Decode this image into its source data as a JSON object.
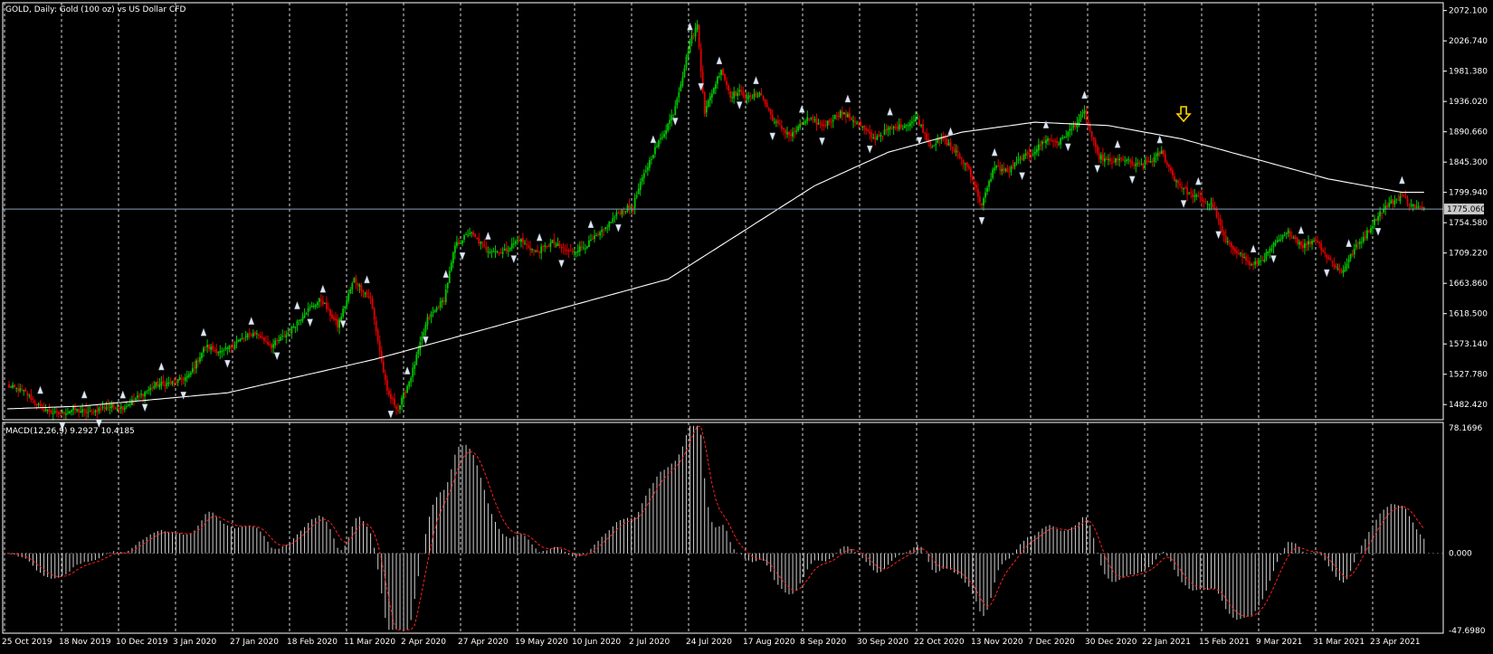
{
  "colors": {
    "background": "#000000",
    "frame": "#ffffff",
    "grid": "#ffffff",
    "bull": "#00c800",
    "bear": "#e00000",
    "ma": "#ffffff",
    "bid_line": "#8aa0b8",
    "macd_hist": "#d0d0d0",
    "macd_signal": "#ff2020",
    "arrow_marker": "#ffd400",
    "price_box": "#c8c8c8",
    "price_box_text": "#000000"
  },
  "chart_data": [
    {
      "type": "candlestick",
      "title": "GOLD, Daily:  Gold (100 oz) vs US Dollar CFD",
      "symbol": "GOLD",
      "timeframe": "Daily",
      "description": "Gold (100 oz) vs US Dollar CFD",
      "current_price": "1775.060",
      "y_ticks": [
        "2072.100",
        "2026.740",
        "1981.380",
        "1936.020",
        "1890.660",
        "1845.300",
        "1799.940",
        "1754.580",
        "1709.220",
        "1663.860",
        "1618.500",
        "1573.140",
        "1527.780",
        "1482.420"
      ],
      "ylim": [
        1459.74,
        2083.8
      ],
      "x_ticks": [
        "25 Oct 2019",
        "18 Nov 2019",
        "10 Dec 2019",
        "3 Jan 2020",
        "27 Jan 2020",
        "18 Feb 2020",
        "11 Mar 2020",
        "2 Apr 2020",
        "27 Apr 2020",
        "19 May 2020",
        "10 Jun 2020",
        "2 Jul 2020",
        "24 Jul 2020",
        "17 Aug 2020",
        "8 Sep 2020",
        "30 Sep 2020",
        "22 Oct 2020",
        "13 Nov 2020",
        "7 Dec 2020",
        "30 Dec 2020",
        "22 Jan 2021",
        "15 Feb 2021",
        "9 Mar 2021",
        "31 Mar 2021",
        "23 Apr 2021"
      ],
      "close_path": [
        [
          0,
          1510
        ],
        [
          6,
          1505
        ],
        [
          10,
          1500
        ],
        [
          18,
          1478
        ],
        [
          27,
          1468
        ],
        [
          36,
          1475
        ],
        [
          45,
          1470
        ],
        [
          54,
          1480
        ],
        [
          63,
          1478
        ],
        [
          72,
          1495
        ],
        [
          81,
          1512
        ],
        [
          90,
          1515
        ],
        [
          99,
          1525
        ],
        [
          108,
          1570
        ],
        [
          117,
          1560
        ],
        [
          126,
          1578
        ],
        [
          135,
          1590
        ],
        [
          144,
          1570
        ],
        [
          153,
          1590
        ],
        [
          162,
          1620
        ],
        [
          171,
          1640
        ],
        [
          180,
          1600
        ],
        [
          189,
          1670
        ],
        [
          198,
          1640
        ],
        [
          207,
          1500
        ],
        [
          213,
          1475
        ],
        [
          220,
          1525
        ],
        [
          229,
          1610
        ],
        [
          238,
          1640
        ],
        [
          244,
          1720
        ],
        [
          252,
          1740
        ],
        [
          261,
          1715
        ],
        [
          270,
          1710
        ],
        [
          279,
          1730
        ],
        [
          288,
          1710
        ],
        [
          297,
          1725
        ],
        [
          306,
          1710
        ],
        [
          315,
          1720
        ],
        [
          324,
          1740
        ],
        [
          333,
          1770
        ],
        [
          341,
          1780
        ],
        [
          346,
          1820
        ],
        [
          352,
          1860
        ],
        [
          358,
          1890
        ],
        [
          363,
          1920
        ],
        [
          368,
          1975
        ],
        [
          372,
          2025
        ],
        [
          376,
          2050
        ],
        [
          380,
          1920
        ],
        [
          384,
          1950
        ],
        [
          389,
          1985
        ],
        [
          394,
          1945
        ],
        [
          399,
          1950
        ],
        [
          405,
          1940
        ],
        [
          410,
          1950
        ],
        [
          418,
          1905
        ],
        [
          427,
          1885
        ],
        [
          436,
          1910
        ],
        [
          445,
          1900
        ],
        [
          454,
          1920
        ],
        [
          463,
          1905
        ],
        [
          472,
          1880
        ],
        [
          481,
          1895
        ],
        [
          488,
          1900
        ],
        [
          496,
          1910
        ],
        [
          503,
          1870
        ],
        [
          510,
          1880
        ],
        [
          517,
          1860
        ],
        [
          524,
          1835
        ],
        [
          531,
          1780
        ],
        [
          538,
          1840
        ],
        [
          545,
          1830
        ],
        [
          552,
          1850
        ],
        [
          559,
          1860
        ],
        [
          566,
          1880
        ],
        [
          573,
          1875
        ],
        [
          580,
          1895
        ],
        [
          587,
          1920
        ],
        [
          594,
          1855
        ],
        [
          601,
          1845
        ],
        [
          608,
          1850
        ],
        [
          615,
          1840
        ],
        [
          622,
          1845
        ],
        [
          629,
          1860
        ],
        [
          636,
          1820
        ],
        [
          643,
          1800
        ],
        [
          650,
          1790
        ],
        [
          657,
          1780
        ],
        [
          664,
          1725
        ],
        [
          671,
          1710
        ],
        [
          678,
          1690
        ],
        [
          684,
          1700
        ],
        [
          690,
          1720
        ],
        [
          698,
          1740
        ],
        [
          706,
          1720
        ],
        [
          713,
          1730
        ],
        [
          720,
          1700
        ],
        [
          727,
          1680
        ],
        [
          734,
          1715
        ],
        [
          741,
          1740
        ],
        [
          748,
          1770
        ],
        [
          754,
          1785
        ],
        [
          760,
          1795
        ],
        [
          766,
          1780
        ],
        [
          771,
          1775
        ]
      ],
      "moving_average_path": [
        [
          0,
          1476
        ],
        [
          40,
          1480
        ],
        [
          80,
          1490
        ],
        [
          120,
          1500
        ],
        [
          160,
          1525
        ],
        [
          200,
          1550
        ],
        [
          240,
          1580
        ],
        [
          280,
          1610
        ],
        [
          320,
          1640
        ],
        [
          360,
          1670
        ],
        [
          400,
          1740
        ],
        [
          440,
          1810
        ],
        [
          480,
          1860
        ],
        [
          520,
          1890
        ],
        [
          560,
          1905
        ],
        [
          600,
          1900
        ],
        [
          640,
          1880
        ],
        [
          680,
          1850
        ],
        [
          720,
          1820
        ],
        [
          760,
          1800
        ],
        [
          771,
          1800
        ]
      ],
      "pivot_marker": {
        "day": 641,
        "direction": "down"
      }
    },
    {
      "type": "histogram+line",
      "title": "MACD(12,26,9) 9.2927 10.4185",
      "macd_value": "9.2927",
      "signal_value": "10.4185",
      "y_ticks": [
        "78.1696",
        "0.000",
        "-47.6980"
      ],
      "ylim": [
        -47.698,
        78.1696
      ],
      "zero_line": 0
    }
  ],
  "ui": {
    "price_box_label": "1775.060"
  }
}
